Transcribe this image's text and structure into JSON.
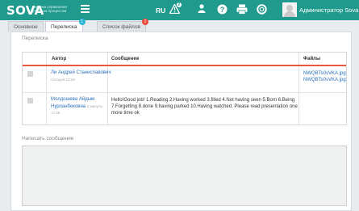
{
  "app": {
    "logo": "SOVA",
    "logo_subtitle": "система управления учебным процессом"
  },
  "header": {
    "language": "RU",
    "notifications_badge": "2",
    "username": "Администратор Sova"
  },
  "tabs": [
    {
      "label": "Основное",
      "badge": ""
    },
    {
      "label": "Переписка",
      "badge": "1",
      "badge_color": "#2ab7d6"
    },
    {
      "label": "Список файлов",
      "badge": "2",
      "badge_color": "#e8483a"
    }
  ],
  "section_title": "Переписка",
  "table": {
    "columns": [
      "Автор",
      "Сообщение",
      "Файлы"
    ],
    "rows": [
      {
        "author": "Ли Андрей Станиславович",
        "date": "Сегодня 13:29",
        "message": "",
        "files": [
          "NWQBTs0vVKA.jpg",
          "NWQBTs0vVKA.jpg"
        ]
      },
      {
        "author": "Молдошева Айдым Нурланбековна",
        "date": "2 минуты 17:49",
        "message": "Hello!Good job! 1.Reading 2.Having worked 3.filled 4.Not having seen 5.Born 6.Being 7.Forgetting 8.done 9.having parked 10.Having watched. Please read presentation one more time ok",
        "files": []
      }
    ]
  },
  "compose": {
    "label": "Написать сообщение",
    "value": ""
  },
  "colors": {
    "header": "#1f9a8c",
    "accent_line": "#e8573e",
    "link": "#2c6fb8"
  }
}
